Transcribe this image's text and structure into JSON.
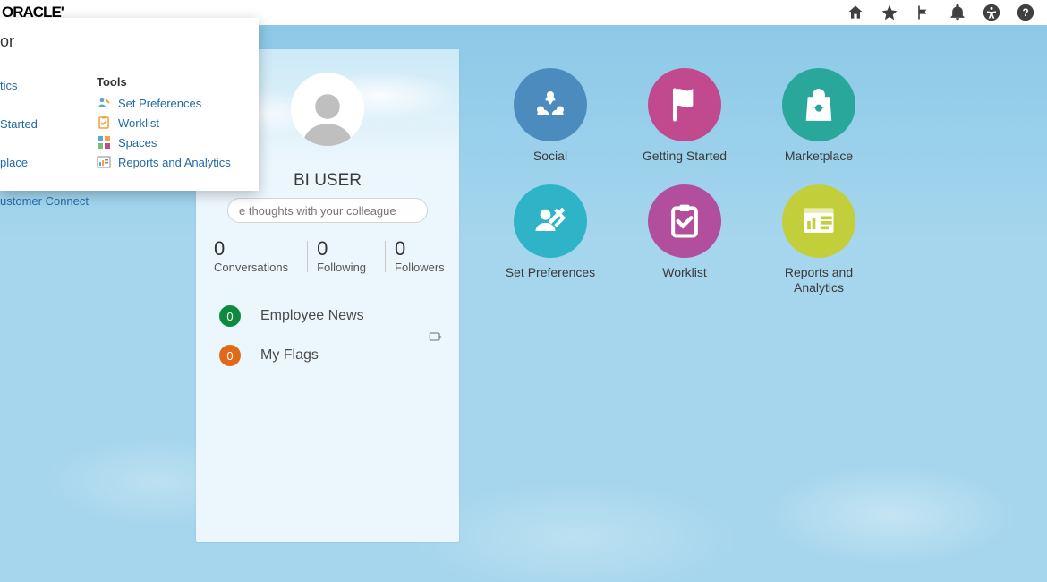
{
  "brand": "ORACLE'",
  "menu": {
    "navigator_suffix": "or",
    "left_links": [
      "tics",
      "Started",
      "place",
      "ustomer Connect"
    ],
    "tools_header": "Tools",
    "tools": [
      {
        "label": "Set Preferences",
        "icon": "set-prefs"
      },
      {
        "label": "Worklist",
        "icon": "worklist"
      },
      {
        "label": "Spaces",
        "icon": "spaces"
      },
      {
        "label": "Reports and Analytics",
        "icon": "reports"
      }
    ]
  },
  "user_card": {
    "name": "BI USER",
    "share_placeholder": "e thoughts with your colleagues...",
    "stats": [
      {
        "value": "0",
        "label": "Conversations"
      },
      {
        "value": "0",
        "label": "Following"
      },
      {
        "value": "0",
        "label": "Followers"
      }
    ],
    "feed": [
      {
        "count": "0",
        "label": "Employee News",
        "color": "green"
      },
      {
        "count": "0",
        "label": "My Flags",
        "color": "orange"
      }
    ]
  },
  "tiles": [
    {
      "label": "Social",
      "color": "#4b8bbe",
      "icon": "social"
    },
    {
      "label": "Getting Started",
      "color": "#c14a8e",
      "icon": "flag"
    },
    {
      "label": "Marketplace",
      "color": "#2aa79b",
      "icon": "bag"
    },
    {
      "label": "Set Preferences",
      "color": "#2fb3c7",
      "icon": "prefs"
    },
    {
      "label": "Worklist",
      "color": "#b24f9d",
      "icon": "clipboard"
    },
    {
      "label": "Reports and Analytics",
      "color": "#c3cf3a",
      "icon": "reports"
    }
  ]
}
